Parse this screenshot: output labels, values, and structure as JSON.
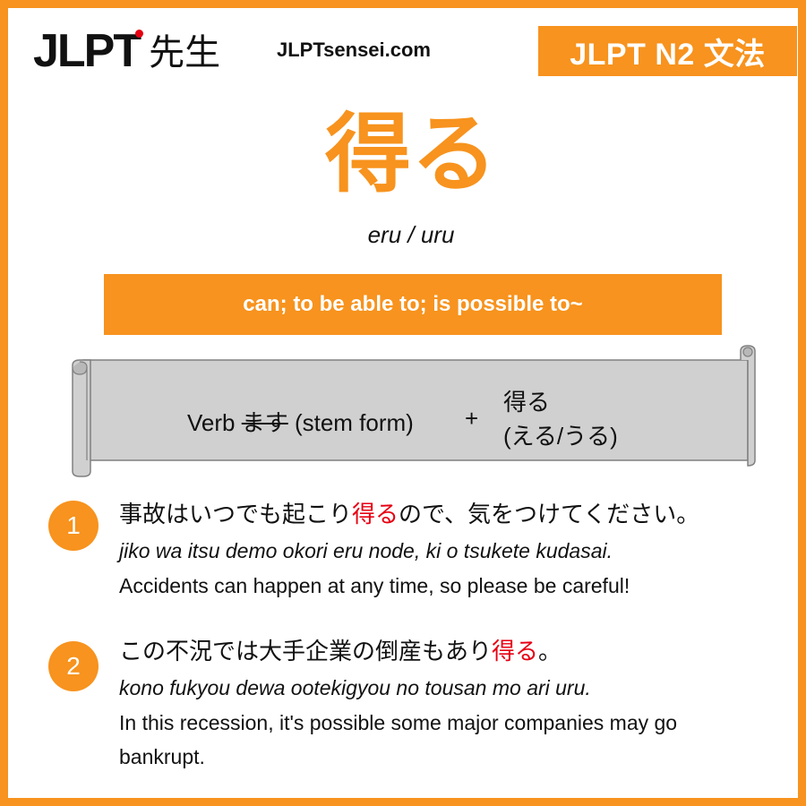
{
  "header": {
    "logo_latin": "JLPT",
    "logo_j": "J",
    "logo_lpt": "LPT",
    "logo_kanji": "先生",
    "site_url": "JLPTsensei.com",
    "level_badge": "JLPT N2 文法"
  },
  "grammar": {
    "title": "得る",
    "romaji": "eru / uru",
    "meaning": "can; to be able to; is possible to~"
  },
  "formula": {
    "verb_label": "Verb ",
    "struck": "ます",
    "stem_label": " (stem form)",
    "plus": "+",
    "form_line1": "得る",
    "form_line2": "(える/うる)"
  },
  "examples": [
    {
      "number": "1",
      "jp_before": "事故はいつでも起こり",
      "jp_highlight": "得る",
      "jp_after": "ので、気をつけてください。",
      "romaji": "jiko wa itsu demo okori eru node, ki o tsukete kudasai.",
      "english": "Accidents can happen at any time, so please be careful!"
    },
    {
      "number": "2",
      "jp_before": "この不況では大手企業の倒産もあり",
      "jp_highlight": "得る",
      "jp_after": "。",
      "romaji": "kono fukyou dewa ootekigyou no tousan mo ari uru.",
      "english": "In this recession, it's possible some major companies may go bankrupt."
    }
  ],
  "colors": {
    "accent": "#f7931e",
    "highlight": "#e60012",
    "scroll_fill": "#d0d0d0",
    "scroll_stroke": "#808080"
  }
}
